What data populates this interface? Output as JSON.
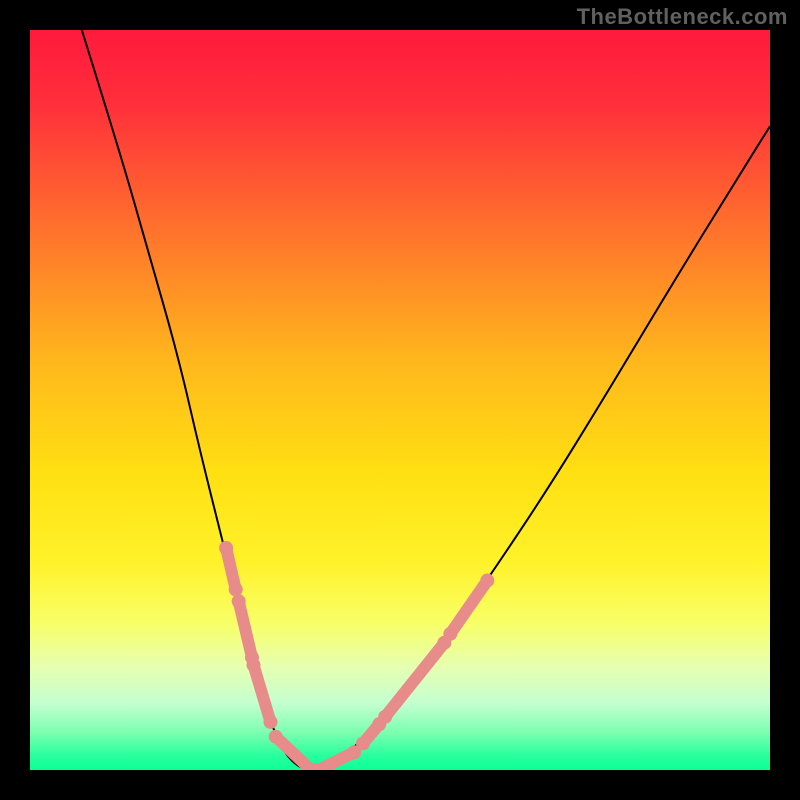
{
  "watermark": "TheBottleneck.com",
  "chart_data": {
    "type": "line",
    "title": "",
    "xlabel": "",
    "ylabel": "",
    "xlim": [
      0,
      1
    ],
    "ylim": [
      0,
      1
    ],
    "gradient_stops": [
      {
        "offset": 0.0,
        "color": "#ff1a3c"
      },
      {
        "offset": 0.1,
        "color": "#ff2f3b"
      },
      {
        "offset": 0.25,
        "color": "#ff6a2e"
      },
      {
        "offset": 0.45,
        "color": "#ffb81c"
      },
      {
        "offset": 0.6,
        "color": "#ffe012"
      },
      {
        "offset": 0.72,
        "color": "#fff22b"
      },
      {
        "offset": 0.8,
        "color": "#f8ff66"
      },
      {
        "offset": 0.86,
        "color": "#e7ffb0"
      },
      {
        "offset": 0.91,
        "color": "#c4ffd0"
      },
      {
        "offset": 0.95,
        "color": "#7affb0"
      },
      {
        "offset": 0.98,
        "color": "#2aff9e"
      },
      {
        "offset": 1.0,
        "color": "#0aff94"
      }
    ],
    "series": [
      {
        "name": "bottleneck-curve",
        "color": "#000000",
        "x": [
          0.07,
          0.12,
          0.16,
          0.2,
          0.23,
          0.26,
          0.285,
          0.305,
          0.32,
          0.335,
          0.35,
          0.37,
          0.39,
          0.42,
          0.47,
          0.55,
          0.62,
          0.7,
          0.78,
          0.87,
          0.95,
          1.0
        ],
        "y": [
          1.0,
          0.84,
          0.7,
          0.56,
          0.43,
          0.31,
          0.21,
          0.13,
          0.08,
          0.04,
          0.015,
          0.0,
          0.0,
          0.015,
          0.06,
          0.16,
          0.26,
          0.38,
          0.51,
          0.66,
          0.79,
          0.87
        ]
      }
    ],
    "markers": {
      "name": "highlight-segments",
      "color": "#e88b8b",
      "stroke": "#e88b8b",
      "lineWidth": 12,
      "dotRadius": 7,
      "segments": [
        {
          "x": [
            0.265,
            0.278
          ],
          "y": [
            0.3,
            0.244
          ]
        },
        {
          "x": [
            0.282,
            0.3
          ],
          "y": [
            0.228,
            0.152
          ]
        },
        {
          "x": [
            0.302,
            0.325
          ],
          "y": [
            0.142,
            0.065
          ]
        },
        {
          "x": [
            0.332,
            0.38
          ],
          "y": [
            0.045,
            0.0
          ]
        },
        {
          "x": [
            0.39,
            0.438
          ],
          "y": [
            0.0,
            0.024
          ]
        },
        {
          "x": [
            0.45,
            0.472
          ],
          "y": [
            0.036,
            0.062
          ]
        },
        {
          "x": [
            0.48,
            0.56
          ],
          "y": [
            0.072,
            0.172
          ]
        },
        {
          "x": [
            0.568,
            0.618
          ],
          "y": [
            0.184,
            0.256
          ]
        }
      ]
    }
  }
}
